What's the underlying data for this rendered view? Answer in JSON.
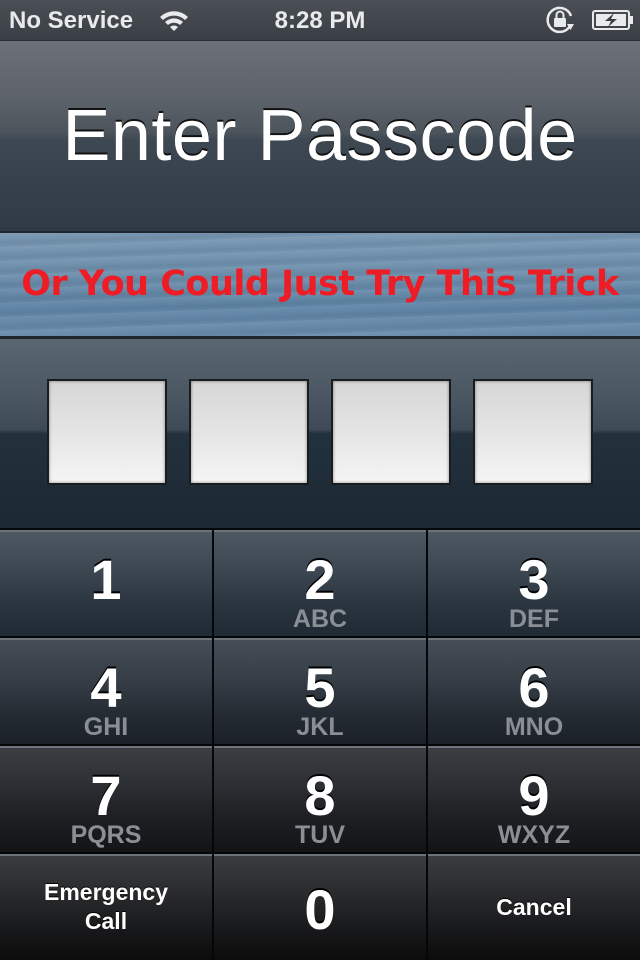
{
  "status_bar": {
    "carrier": "No Service",
    "wifi_icon": "wifi-icon",
    "time": "8:28 PM",
    "rotation_lock_icon": "rotation-lock-icon",
    "battery_icon": "battery-charging-icon"
  },
  "header": {
    "title": "Enter Passcode"
  },
  "banner": {
    "text": "Or You Could Just Try This Trick",
    "color": "#ee1c25"
  },
  "passcode": {
    "length": 4,
    "entered": 0
  },
  "keypad": {
    "keys": [
      {
        "digit": "1",
        "letters": ""
      },
      {
        "digit": "2",
        "letters": "ABC"
      },
      {
        "digit": "3",
        "letters": "DEF"
      },
      {
        "digit": "4",
        "letters": "GHI"
      },
      {
        "digit": "5",
        "letters": "JKL"
      },
      {
        "digit": "6",
        "letters": "MNO"
      },
      {
        "digit": "7",
        "letters": "PQRS"
      },
      {
        "digit": "8",
        "letters": "TUV"
      },
      {
        "digit": "9",
        "letters": "WXYZ"
      }
    ],
    "emergency_line1": "Emergency",
    "emergency_line2": "Call",
    "zero": "0",
    "cancel": "Cancel"
  }
}
